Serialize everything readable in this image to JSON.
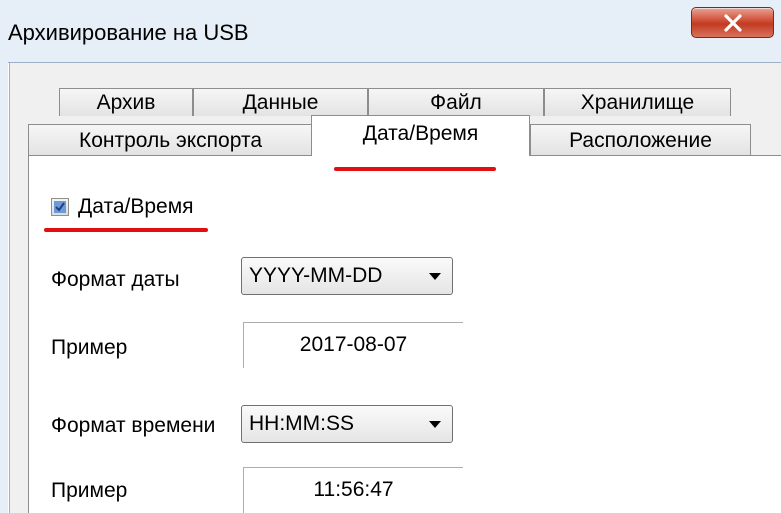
{
  "window": {
    "title": "Архивирование на USB",
    "close_icon": "close-icon"
  },
  "tabs": {
    "row1": [
      {
        "label": "Архив"
      },
      {
        "label": "Данные"
      },
      {
        "label": "Файл"
      },
      {
        "label": "Хранилище"
      }
    ],
    "row2": [
      {
        "label": "Контроль экспорта"
      },
      {
        "label": "Дата/Время",
        "selected": true
      },
      {
        "label": "Расположение"
      }
    ]
  },
  "datetime": {
    "enable_label": "Дата/Время",
    "enabled": true,
    "date_format_label": "Формат даты",
    "date_format_value": "YYYY-MM-DD",
    "date_example_label": "Пример",
    "date_example_value": "2017-08-07",
    "time_format_label": "Формат времени",
    "time_format_value": "HH:MM:SS",
    "time_example_label": "Пример",
    "time_example_value": "11:56:47"
  },
  "annotations": {
    "highlight_color": "#e01010"
  }
}
